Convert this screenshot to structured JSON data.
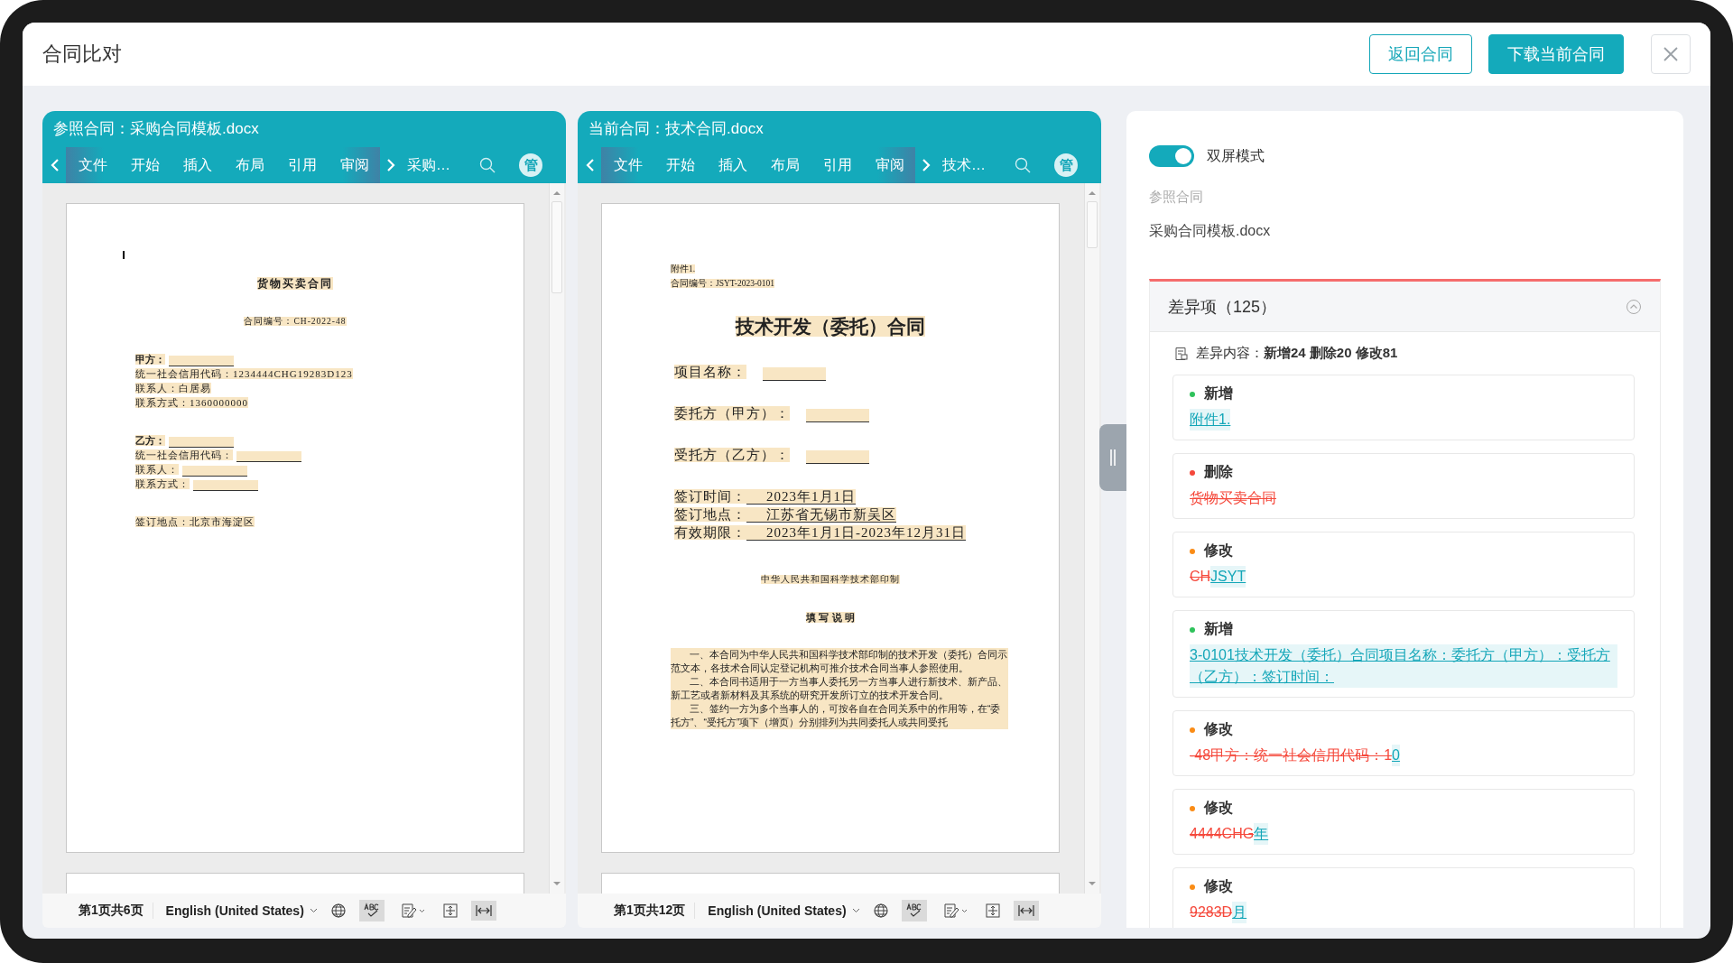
{
  "header": {
    "title": "合同比对",
    "buttons": [
      {
        "label": "返回合同",
        "kind": "outline"
      },
      {
        "label": "下载当前合同",
        "kind": "primary"
      }
    ]
  },
  "documents": [
    {
      "title": "参照合同：采购合同模板.docx",
      "tabs": [
        "文件",
        "开始",
        "插入",
        "布局",
        "引用",
        "审阅"
      ],
      "overflow_label": "采购…",
      "avatar": "管",
      "status": {
        "page_info": "第1页共6页",
        "language": "English (United States)"
      },
      "sections": [
        {
          "lines": [
            {
              "kind": "title",
              "text": "货物买卖合同"
            }
          ]
        },
        {
          "lines": [
            {
              "kind": "center",
              "text": "合同编号：CH-2022-48"
            }
          ]
        },
        {
          "lines": [
            {
              "kind": "bold",
              "text": "甲方：",
              "blank": true
            },
            {
              "kind": "text",
              "text": "统一社会信用代码：1234444CHG19283D123"
            },
            {
              "kind": "text",
              "text": "联系人：白居易"
            },
            {
              "kind": "text",
              "text": "联系方式：1360000000"
            }
          ]
        },
        {
          "lines": [
            {
              "kind": "bold",
              "text": "乙方：",
              "blank": true
            },
            {
              "kind": "text",
              "text": "统一社会信用代码：",
              "blank": true
            },
            {
              "kind": "text",
              "text": "联系人：",
              "blank": true
            },
            {
              "kind": "text",
              "text": "联系方式：",
              "blank": true
            }
          ]
        },
        {
          "lines": [
            {
              "kind": "text",
              "text": "签订地点：北京市海淀区"
            }
          ]
        }
      ]
    },
    {
      "title": "当前合同：技术合同.docx",
      "tabs": [
        "文件",
        "开始",
        "插入",
        "布局",
        "引用",
        "审阅"
      ],
      "overflow_label": "技术…",
      "avatar": "管",
      "status": {
        "page_info": "第1页共12页",
        "language": "English (United States)"
      },
      "sections": [
        {
          "lines": [
            {
              "kind": "note",
              "text": "附件1."
            },
            {
              "kind": "note",
              "text": "合同编号：JSYT-2023-0101"
            }
          ]
        },
        {
          "lines": [
            {
              "kind": "big-title",
              "text": "技术开发（委托）合同"
            }
          ]
        },
        {
          "lines": [
            {
              "kind": "field",
              "text": "项目名称：",
              "blank": true
            }
          ]
        },
        {
          "lines": [
            {
              "kind": "field",
              "text": "委托方（甲方）：",
              "blank": true
            }
          ]
        },
        {
          "lines": [
            {
              "kind": "field",
              "text": "受托方（乙方）：",
              "blank": true
            }
          ]
        },
        {
          "lines": [
            {
              "kind": "field",
              "text": "签订时间：",
              "value": "2023年1月1日"
            },
            {
              "kind": "field",
              "text": "签订地点：",
              "value": "江苏省无锡市新吴区"
            },
            {
              "kind": "field",
              "text": "有效期限：",
              "value": "2023年1月1日-2023年12月31日"
            }
          ]
        },
        {
          "lines": [
            {
              "kind": "center",
              "text": "中华人民共和国科学技术部印制"
            }
          ]
        },
        {
          "lines": [
            {
              "kind": "heading",
              "text": "填 写 说 明"
            }
          ]
        },
        {
          "lines": [
            {
              "kind": "para",
              "text": "一、本合同为中华人民共和国科学技术部印制的技术开发（委托）合同示范文本，各技术合同认定登记机构可推介技术合同当事人参照使用。"
            },
            {
              "kind": "para",
              "text": "二、本合同书适用于一方当事人委托另一方当事人进行新技术、新产品、新工艺或者新材料及其系统的研究开发所订立的技术开发合同。"
            },
            {
              "kind": "para",
              "text": "三、签约一方为多个当事人的，可按各自在合同关系中的作用等，在“委托方”、“受托方”项下（增页）分别排列为共同委托人或共同受托"
            }
          ]
        }
      ]
    }
  ],
  "panel": {
    "mode_toggle": {
      "label": "双屏模式",
      "on": true
    },
    "reference_label": "参照合同",
    "reference_file": "采购合同模板.docx",
    "diff": {
      "title": "差异项（125）",
      "expanded": true,
      "summary": "差异内容：**新增24 删除20 修改81**",
      "items": [
        {
          "kind": "add",
          "label": "新增",
          "added": "附件1."
        },
        {
          "kind": "delete",
          "label": "删除",
          "removed": "货物买卖合同"
        },
        {
          "kind": "modify",
          "label": "修改",
          "removed": "CH",
          "added": "JSYT"
        },
        {
          "kind": "add",
          "label": "新增",
          "added": "3-0101技术开发（委托）合同项目名称：委托方（甲方）：受托方（乙方）：签订时间："
        },
        {
          "kind": "modify",
          "label": "修改",
          "removed": "-48甲方：统一社会信用代码：1",
          "added": "0"
        },
        {
          "kind": "modify",
          "label": "修改",
          "removed": "4444CHG",
          "added": "年"
        },
        {
          "kind": "modify",
          "label": "修改",
          "removed": "9283D",
          "added": "月"
        }
      ]
    }
  }
}
